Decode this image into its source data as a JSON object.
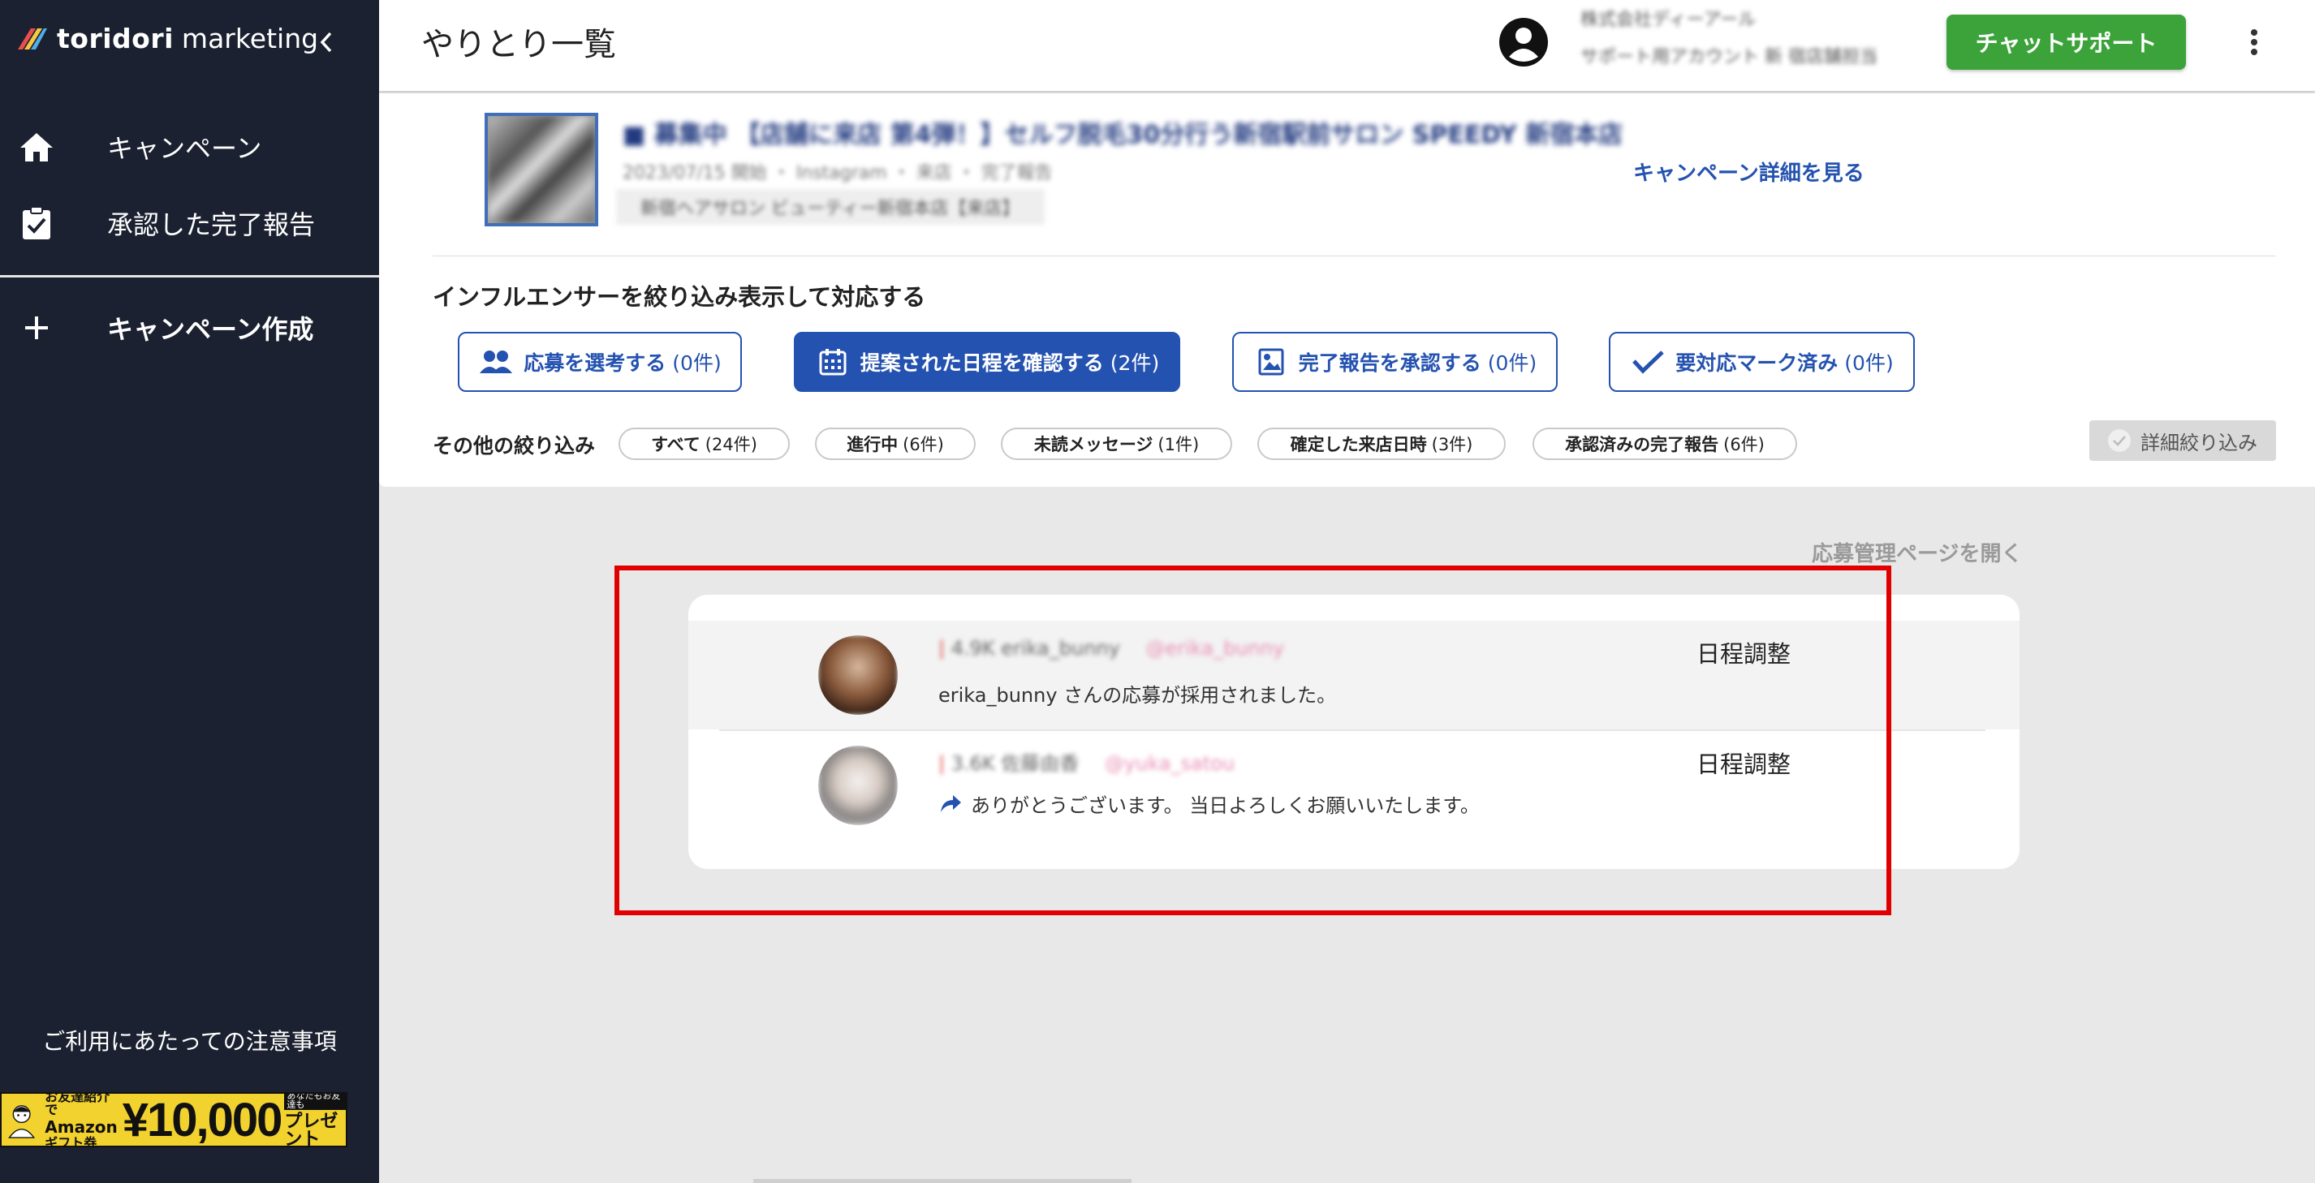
{
  "brand": {
    "name": "toridori",
    "sub": "marketing"
  },
  "sidebar": {
    "items": [
      {
        "label": "キャンペーン",
        "icon": "home-icon"
      },
      {
        "label": "承認した完了報告",
        "icon": "clipboard-check-icon"
      },
      {
        "label": "キャンペーン作成",
        "icon": "plus-icon"
      }
    ],
    "notice": "ご利用にあたっての注意事項",
    "promo": {
      "line1": "お友達紹介で",
      "line2": "Amazon",
      "line3": "ギフト券",
      "amount": "¥10,000",
      "tag": "あなたもお友達も",
      "suffix": "プレゼント"
    }
  },
  "header": {
    "title": "やりとり一覧",
    "account_line1": "株式会社ディーアール",
    "account_line2": "サポート用アカウント 新 宿店舗担当",
    "chat_button": "チャットサポート"
  },
  "campaign": {
    "title": "■ 募集中 【店舗に来店 第4弾！】セルフ脱毛30分行う新宿駅前サロン SPEEDY 新宿本店",
    "meta": "2023/07/15 開始 ・ Instagram ・ 来店 ・ 完了報告",
    "tag": "新宿ヘアサロン ビューティー新宿本店【来店】",
    "detail_link": "キャンペーン詳細を見る"
  },
  "filters": {
    "heading": "インフルエンサーを絞り込み表示して対応する",
    "buttons": [
      {
        "label": "応募を選考する",
        "count": "(0件)",
        "icon": "people-icon",
        "active": false
      },
      {
        "label": "提案された日程を確認する",
        "count": "(2件)",
        "icon": "calendar-icon",
        "active": true
      },
      {
        "label": "完了報告を承認する",
        "count": "(0件)",
        "icon": "report-image-icon",
        "active": false
      },
      {
        "label": "要対応マーク済み",
        "count": "(0件)",
        "icon": "checkmark-icon",
        "active": false
      }
    ],
    "other_label": "その他の絞り込み",
    "chips": [
      {
        "label": "すべて",
        "count": "(24件)"
      },
      {
        "label": "進行中",
        "count": "(6件)"
      },
      {
        "label": "未読メッセージ",
        "count": "(1件)"
      },
      {
        "label": "確定した来店日時",
        "count": "(3件)"
      },
      {
        "label": "承認済みの完了報告",
        "count": "(6件)"
      }
    ],
    "detail_button": "詳細絞り込み"
  },
  "messages": {
    "open_link": "応募管理ページを開く",
    "rows": [
      {
        "name": "4.9K erika_bunny",
        "handle": "@erika_bunny",
        "status": "日程調整",
        "text": "erika_bunny さんの応募が採用されました。",
        "is_reply": false
      },
      {
        "name": "3.6K 佐藤由香",
        "handle": "@yuka_satou",
        "status": "日程調整",
        "text": "ありがとうございます。 当日よろしくお願いいたします。",
        "is_reply": true
      }
    ]
  },
  "colors": {
    "sidebar": "#1b2130",
    "accent_blue": "#2452b0",
    "chat_green": "#3ba33a",
    "highlight_red": "#e00000"
  }
}
